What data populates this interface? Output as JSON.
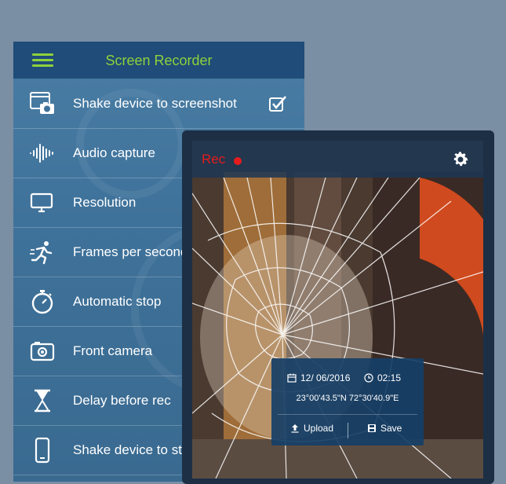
{
  "header": {
    "title": "Screen Recorder"
  },
  "settings": {
    "items": [
      {
        "label": "Shake device to screenshot",
        "icon": "screenshot-camera-icon",
        "checked": true
      },
      {
        "label": "Audio capture",
        "icon": "audio-waveform-icon"
      },
      {
        "label": "Resolution",
        "icon": "monitor-icon"
      },
      {
        "label": "Frames per second",
        "icon": "runner-icon"
      },
      {
        "label": "Automatic stop",
        "icon": "stopwatch-icon"
      },
      {
        "label": "Front camera",
        "icon": "front-camera-icon"
      },
      {
        "label": "Delay before rec",
        "icon": "hourglass-icon"
      },
      {
        "label": "Shake device to stop",
        "icon": "phone-icon"
      }
    ]
  },
  "recorder": {
    "rec_label": "Rec",
    "date": "12/ 06/2016",
    "time": "02:15",
    "coordinates": "23°00'43.5\"N 72°30'40.9\"E",
    "upload_label": "Upload",
    "save_label": "Save"
  },
  "colors": {
    "accent_green": "#8fd13c",
    "rec_red": "#e51c1c",
    "bar_blue": "#1f4c78"
  }
}
